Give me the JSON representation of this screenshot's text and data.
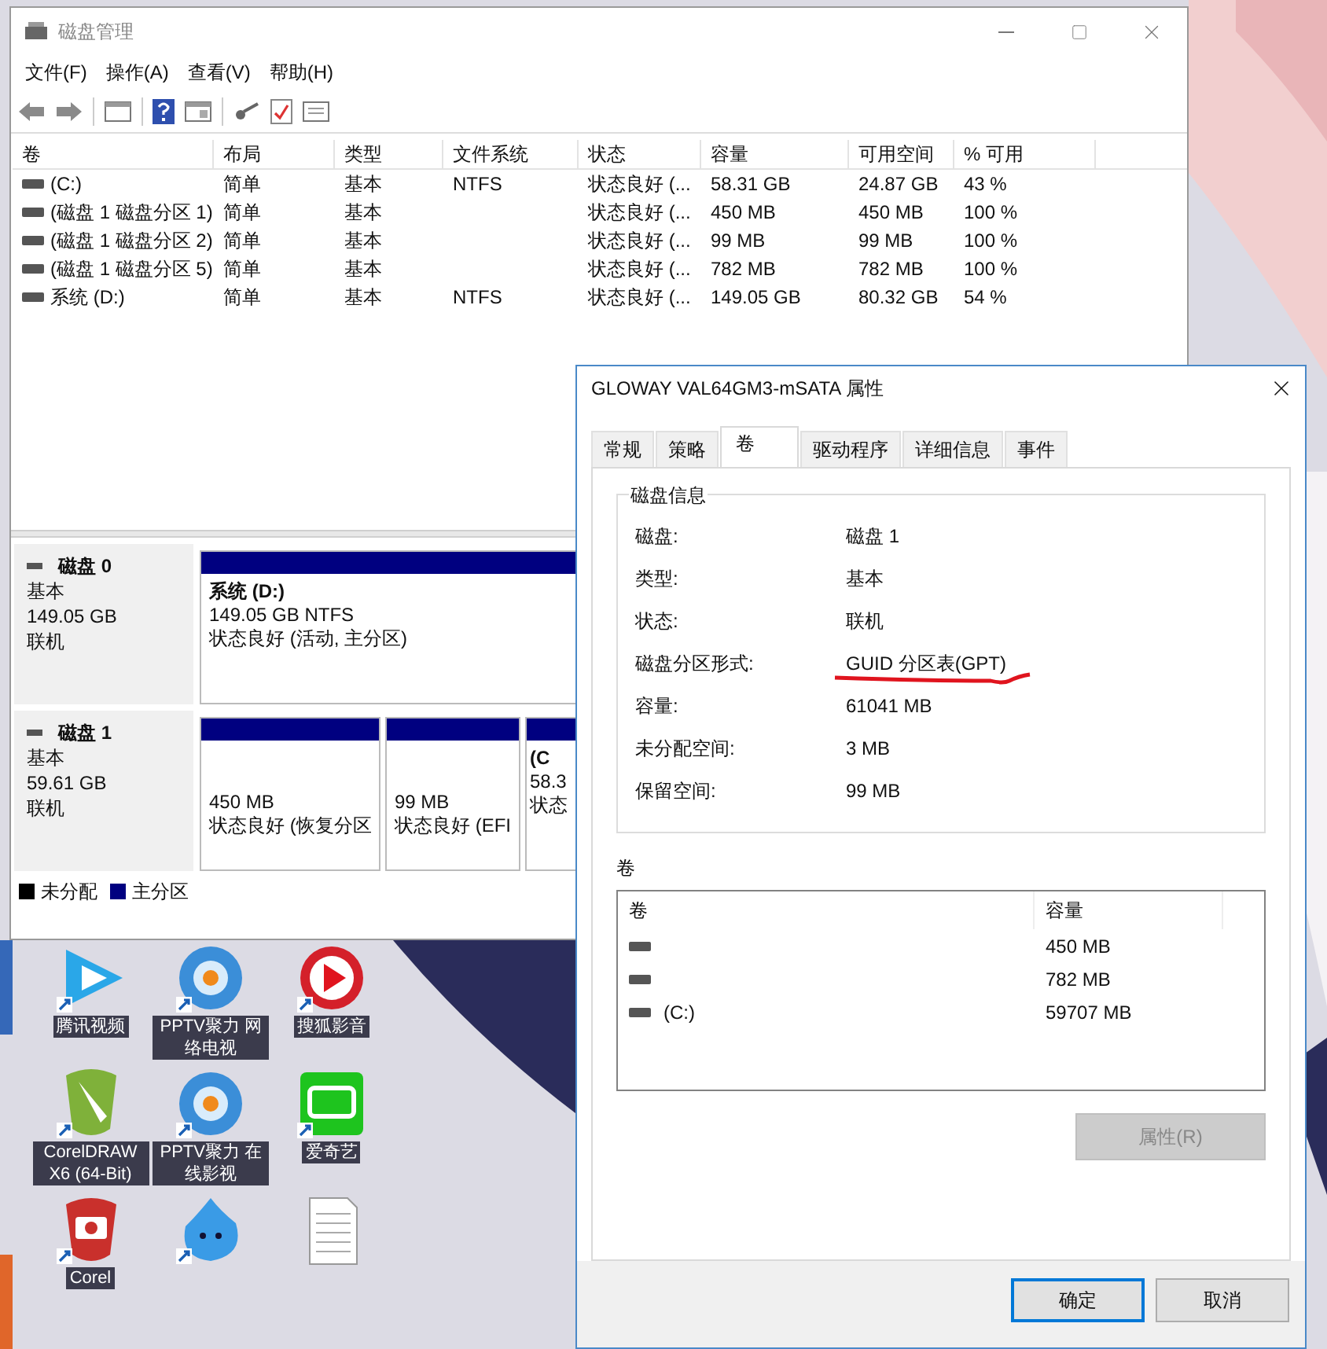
{
  "desktop": {
    "icons": [
      {
        "label": "腾讯视频",
        "kind": "play"
      },
      {
        "label": "PPTV聚力 网络电视",
        "kind": "disc"
      },
      {
        "label": "搜狐影音",
        "kind": "redplay"
      },
      {
        "label": "CorelDRAW X6 (64-Bit)",
        "kind": "pen"
      },
      {
        "label": "PPTV聚力 在线影视",
        "kind": "disc"
      },
      {
        "label": "爱奇艺",
        "kind": "green"
      },
      {
        "label": "Corel",
        "kind": "camera"
      },
      {
        "kind": "blob"
      },
      {
        "kind": "document"
      }
    ]
  },
  "disk_management": {
    "title": "磁盘管理",
    "menu": [
      "文件(F)",
      "操作(A)",
      "查看(V)",
      "帮助(H)"
    ],
    "volumes": {
      "columns": [
        "卷",
        "布局",
        "类型",
        "文件系统",
        "状态",
        "容量",
        "可用空间",
        "% 可用"
      ],
      "rows": [
        [
          "(C:)",
          "简单",
          "基本",
          "NTFS",
          "状态良好 (...",
          "58.31 GB",
          "24.87 GB",
          "43 %"
        ],
        [
          "(磁盘 1 磁盘分区 1)",
          "简单",
          "基本",
          "",
          "状态良好 (...",
          "450 MB",
          "450 MB",
          "100 %"
        ],
        [
          "(磁盘 1 磁盘分区 2)",
          "简单",
          "基本",
          "",
          "状态良好 (...",
          "99 MB",
          "99 MB",
          "100 %"
        ],
        [
          "(磁盘 1 磁盘分区 5)",
          "简单",
          "基本",
          "",
          "状态良好 (...",
          "782 MB",
          "782 MB",
          "100 %"
        ],
        [
          "系统 (D:)",
          "简单",
          "基本",
          "NTFS",
          "状态良好 (...",
          "149.05 GB",
          "80.32 GB",
          "54 %"
        ]
      ]
    },
    "disks": [
      {
        "name": "磁盘 0",
        "type": "基本",
        "size": "149.05 GB",
        "status": "联机",
        "partitions": [
          {
            "label": "系统  (D:)",
            "size": "149.05 GB NTFS",
            "status": "状态良好 (活动, 主分区)"
          }
        ]
      },
      {
        "name": "磁盘 1",
        "type": "基本",
        "size": "59.61 GB",
        "status": "联机",
        "partitions": [
          {
            "size": "450 MB",
            "status": "状态良好 (恢复分区"
          },
          {
            "size": "99 MB",
            "status": "状态良好 (EFI"
          },
          {
            "label": "(C",
            "size": "58.3",
            "status": "状态"
          }
        ]
      }
    ],
    "legend": [
      {
        "label": "未分配",
        "color": "#000000"
      },
      {
        "label": "主分区",
        "color": "#000080"
      }
    ]
  },
  "properties_dialog": {
    "title": "GLOWAY VAL64GM3-mSATA 属性",
    "tabs": [
      {
        "label": "常规",
        "selected": false
      },
      {
        "label": "策略",
        "selected": false
      },
      {
        "label": "卷",
        "selected": true
      },
      {
        "label": "驱动程序",
        "selected": false
      },
      {
        "label": "详细信息",
        "selected": false
      },
      {
        "label": "事件",
        "selected": false
      }
    ],
    "group_title": "磁盘信息",
    "fields": [
      {
        "label": "磁盘:",
        "value": "磁盘 1",
        "annotated": false
      },
      {
        "label": "类型:",
        "value": "基本",
        "annotated": false
      },
      {
        "label": "状态:",
        "value": "联机",
        "annotated": false
      },
      {
        "label": "磁盘分区形式:",
        "value": "GUID 分区表(GPT)",
        "annotated": true
      },
      {
        "label": "容量:",
        "value": "61041 MB",
        "annotated": false
      },
      {
        "label": "未分配空间:",
        "value": "3 MB",
        "annotated": false
      },
      {
        "label": "保留空间:",
        "value": "99 MB",
        "annotated": false
      }
    ],
    "volumes_label": "卷",
    "volume_list": {
      "columns": [
        "卷",
        "容量"
      ],
      "rows": [
        {
          "size": "450 MB"
        },
        {
          "size": "782 MB"
        },
        {
          "name": "(C:)",
          "size": "59707 MB"
        }
      ]
    },
    "properties_button": {
      "label": "属性(R)",
      "disabled": true
    },
    "footer_buttons": [
      {
        "label": "确定",
        "default": true
      },
      {
        "label": "取消",
        "default": false
      }
    ]
  }
}
